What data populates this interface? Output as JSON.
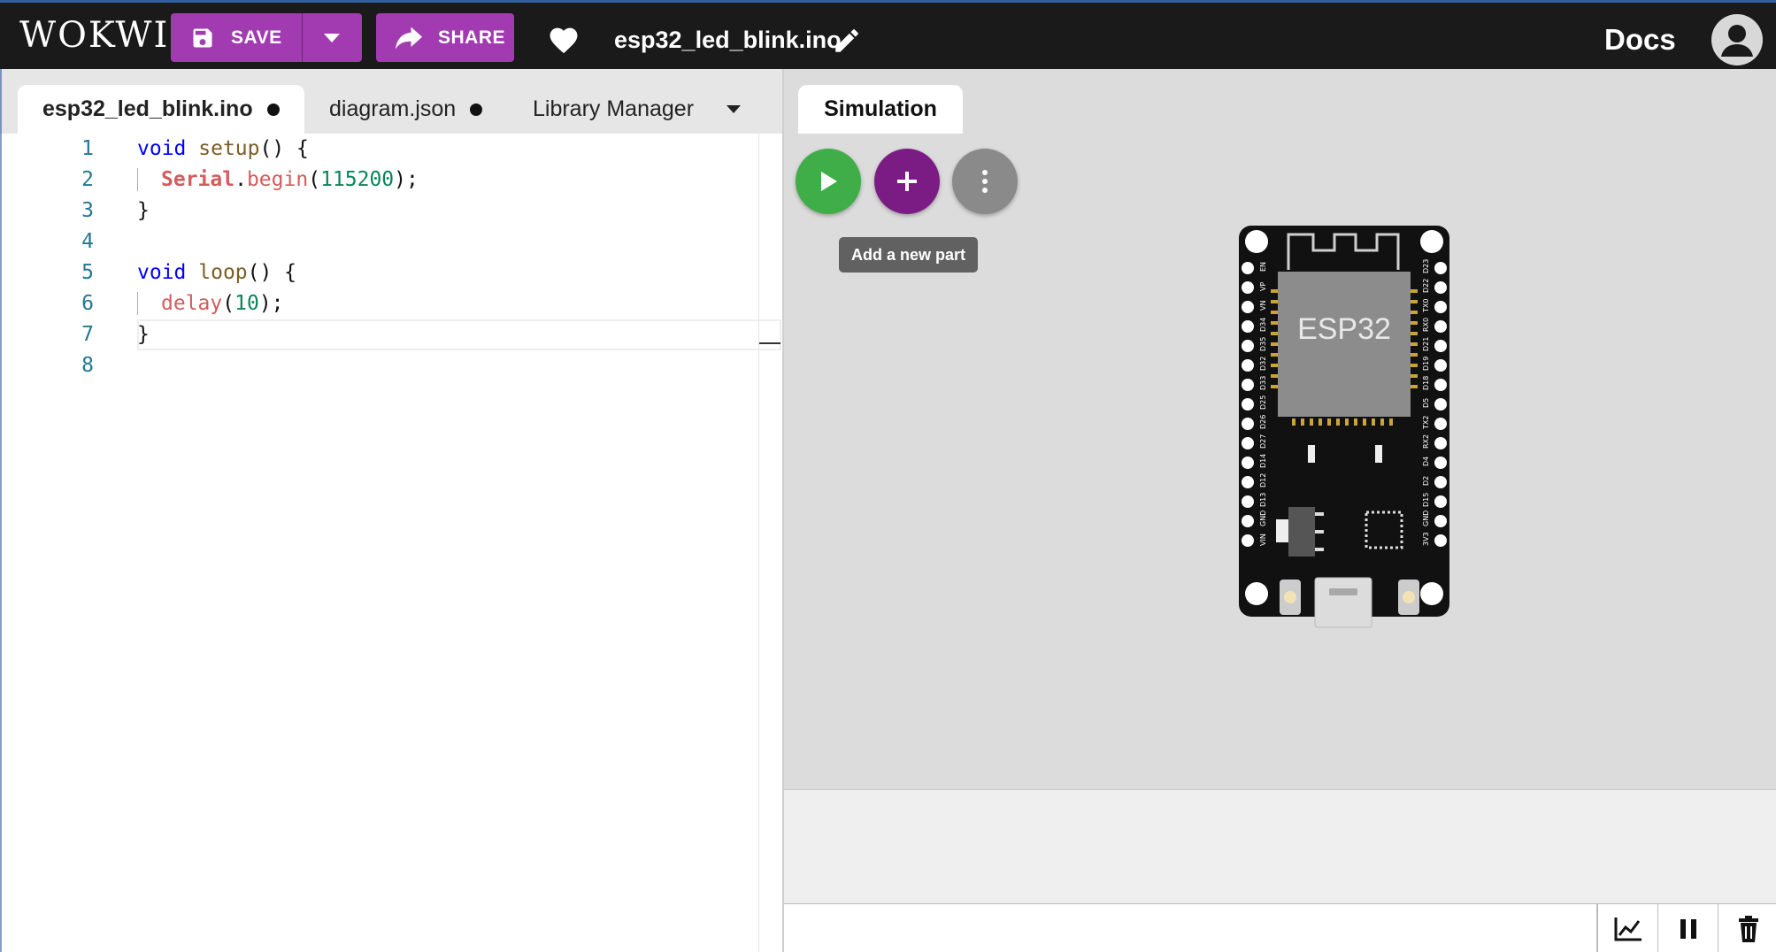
{
  "header": {
    "logo": "WOKWI",
    "save_label": "SAVE",
    "share_label": "SHARE",
    "project_name": "esp32_led_blink.ino",
    "docs_label": "Docs",
    "accent_color": "#a23bb2"
  },
  "editor": {
    "tabs": [
      {
        "label": "esp32_led_blink.ino",
        "modified": true,
        "active": true
      },
      {
        "label": "diagram.json",
        "modified": true,
        "active": false
      },
      {
        "label": "Library Manager",
        "modified": false,
        "active": false
      }
    ],
    "line_numbers": [
      "1",
      "2",
      "3",
      "4",
      "5",
      "6",
      "7",
      "8"
    ],
    "code": {
      "l1_kw": "void",
      "l1_fn": "setup",
      "l1_rest": "() {",
      "l2_obj": "Serial",
      "l2_dot": ".",
      "l2_meth": "begin",
      "l2_open": "(",
      "l2_num": "115200",
      "l2_close": ");",
      "l3": "}",
      "l5_kw": "void",
      "l5_fn": "loop",
      "l5_rest": "() {",
      "l6_meth": "delay",
      "l6_open": "(",
      "l6_num": "10",
      "l6_close": ");",
      "l7": "}"
    }
  },
  "simulation": {
    "tab_label": "Simulation",
    "tooltip": "Add a new part",
    "board_label": "ESP32",
    "pins_left": [
      "EN",
      "VP",
      "VN",
      "D34",
      "D35",
      "D32",
      "D33",
      "D25",
      "D26",
      "D27",
      "D14",
      "D12",
      "D13",
      "GND",
      "VIN"
    ],
    "pins_right": [
      "D23",
      "D22",
      "TX0",
      "RX0",
      "D21",
      "D19",
      "D18",
      "D5",
      "TX2",
      "RX2",
      "D4",
      "D2",
      "D15",
      "GND",
      "3V3"
    ]
  },
  "icons": {
    "save": "floppy-disk-icon",
    "share": "share-arrow-icon",
    "favorite": "heart-icon",
    "edit": "pencil-icon",
    "user": "user-avatar-icon",
    "play": "play-icon",
    "add": "plus-icon",
    "more": "more-vertical-icon",
    "plotter": "chart-line-icon",
    "pause": "pause-icon",
    "clear": "trash-icon"
  }
}
